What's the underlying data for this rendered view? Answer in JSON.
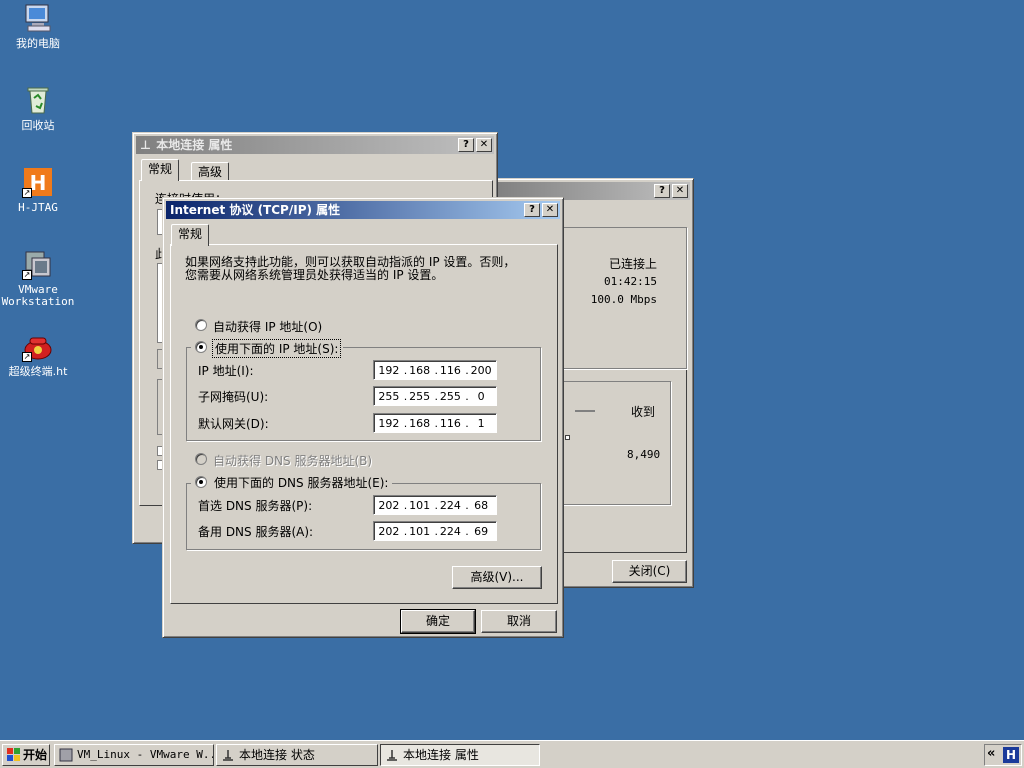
{
  "desktop": {
    "icons": [
      {
        "label": "我的电脑",
        "icon": "my-computer-icon"
      },
      {
        "label": "回收站",
        "icon": "recycle-bin-icon"
      },
      {
        "label": "H-JTAG",
        "icon": "h-jtag-icon"
      },
      {
        "label1": "VMware",
        "label2": "Workstation",
        "icon": "vmware-icon"
      },
      {
        "label": "超级终端.ht",
        "icon": "hyperterminal-icon"
      }
    ]
  },
  "props_window": {
    "title": "本地连接 属性",
    "tabs": [
      "常规",
      "高级"
    ],
    "partial_text": "连接时使用：",
    "partial_char": "此"
  },
  "status_window": {
    "state_value": "已连接上",
    "duration_value": "01:42:15",
    "speed_value": "100.0 Mbps",
    "received_label": "收到",
    "received_value": "8,490",
    "close_label": "关闭(C)"
  },
  "tcpip": {
    "title": "Internet 协议 (TCP/IP) 属性",
    "tab": "常规",
    "description": "如果网络支持此功能，则可以获取自动指派的 IP 设置。否则，您需要从网络系统管理员处获得适当的 IP 设置。",
    "auto_ip_label": "自动获得 IP 地址(O)",
    "manual_ip_label": "使用下面的 IP 地址(S):",
    "ip_label": "IP 地址(I):",
    "ip": [
      "192",
      "168",
      "116",
      "200"
    ],
    "mask_label": "子网掩码(U):",
    "mask": [
      "255",
      "255",
      "255",
      "0"
    ],
    "gateway_label": "默认网关(D):",
    "gateway": [
      "192",
      "168",
      "116",
      "1"
    ],
    "auto_dns_label": "自动获得 DNS 服务器地址(B)",
    "manual_dns_label": "使用下面的 DNS 服务器地址(E):",
    "pref_dns_label": "首选 DNS 服务器(P):",
    "pref_dns": [
      "202",
      "101",
      "224",
      "68"
    ],
    "alt_dns_label": "备用 DNS 服务器(A):",
    "alt_dns": [
      "202",
      "101",
      "224",
      "69"
    ],
    "advanced_label": "高级(V)...",
    "ok_label": "确定",
    "cancel_label": "取消"
  },
  "taskbar": {
    "start_label": "开始",
    "items": [
      "VM_Linux - VMware W...",
      "本地连接 状态",
      "本地连接 属性"
    ],
    "tray_arrow": "«",
    "tray_icon_letter": "H"
  }
}
